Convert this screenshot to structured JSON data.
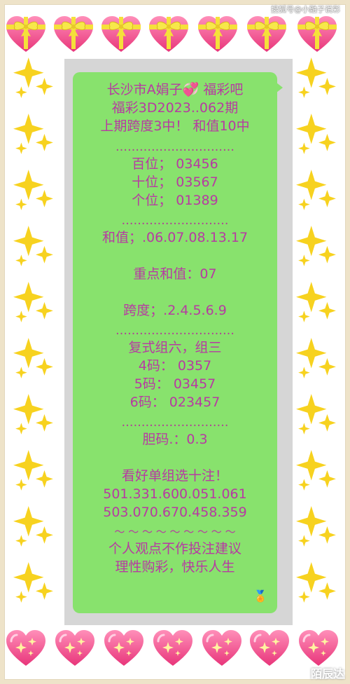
{
  "watermark": "搜狐号@小融子说彩",
  "corner_logo": "陌辰达",
  "post": {
    "line_1": "长沙市A娟子💞 福彩吧",
    "line_2": "福彩3D2023..062期",
    "line_3": "上期跨度3中！ 和值10中",
    "separator_1": "…………………………",
    "hundreds": "百位； 03456",
    "tens": "十位； 03567",
    "units": "个位； 01389",
    "separator_2": "………………………",
    "sum": "和值；.06.07.08.13.17",
    "key_sum": "重点和值：07",
    "span": "跨度；.2.4.5.6.9",
    "separator_3": "…………………………",
    "compound": "复式组六，组三",
    "code_4": "4码：  0357",
    "code_5": "5码：  03457",
    "code_6": "6码： 023457",
    "separator_4": "………………………",
    "courage": "胆码.：0.3",
    "favorite": "看好单组选十注！",
    "picks_1": "501.331.600.051.061",
    "picks_2": "503.070.670.458.359",
    "tilde": "～ ～ ～ ～ ～ ～ ～ ～ ～",
    "disclaimer_1": "个人观点不作投注建议",
    "disclaimer_2": "理性购彩，快乐人生",
    "medal": "🏅"
  },
  "colors": {
    "bubble": "#88e26d",
    "text": "#b73aa2",
    "heart": "#f2548e",
    "ribbon": "#f5e03a",
    "sparkle": "#f7d21f"
  }
}
